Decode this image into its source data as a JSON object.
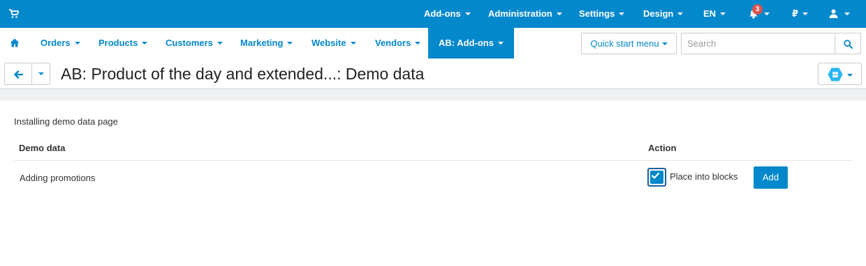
{
  "topbar": {
    "cart_icon": "shopping-cart-icon",
    "items": [
      {
        "label": "Add-ons"
      },
      {
        "label": "Administration"
      },
      {
        "label": "Settings"
      },
      {
        "label": "Design"
      },
      {
        "label": "EN"
      }
    ],
    "notifications_count": "3",
    "currency": "₽",
    "bell_icon": "bell-icon",
    "user_icon": "user-icon"
  },
  "nav": {
    "home_icon": "home-icon",
    "items": [
      {
        "label": "Orders"
      },
      {
        "label": "Products"
      },
      {
        "label": "Customers"
      },
      {
        "label": "Marketing"
      },
      {
        "label": "Website"
      },
      {
        "label": "Vendors"
      },
      {
        "label": "AB: Add-ons",
        "active": true
      }
    ],
    "quick_start_label": "Quick start menu",
    "search_placeholder": "Search",
    "search_value": ""
  },
  "titlebar": {
    "title": "AB: Product of the day and extended...: Demo data",
    "back_icon": "arrow-left-icon",
    "addon_icon": "addon-hexagon-icon"
  },
  "content": {
    "heading": "Installing demo data page",
    "table": {
      "headers": [
        "Demo data",
        "Action"
      ],
      "rows": [
        {
          "name": "Adding promotions",
          "checkbox_label": "Place into blocks",
          "checked": true,
          "button_label": "Add"
        }
      ]
    }
  },
  "colors": {
    "primary": "#0388cc",
    "badge": "#d9534f",
    "checkbox_border": "#1a5f9c"
  }
}
